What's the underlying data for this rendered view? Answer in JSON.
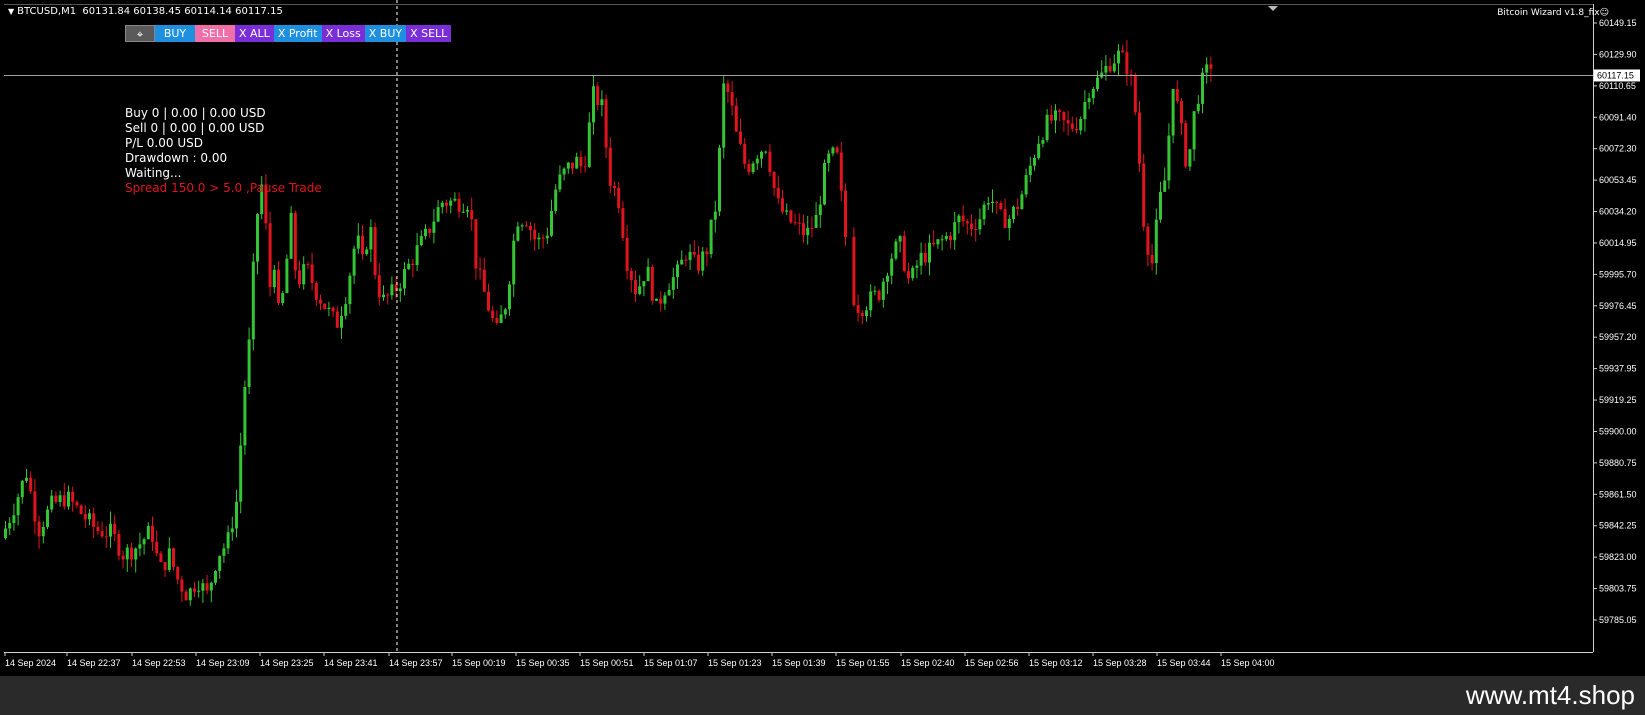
{
  "header": {
    "symbol_line": "BTCUSD,M1  60131.84 60138.45 60114.14 60117.15",
    "ea_label": "Bitcoin Wizard v1.8_fix☺"
  },
  "toolbar": {
    "move_icon": "move-icon",
    "buy": "BUY",
    "sell": "SELL",
    "x_all": "X ALL",
    "x_profit": "X Profit",
    "x_loss": "X Loss",
    "x_buy": "X BUY",
    "x_sell": "X SELL"
  },
  "info_panel": {
    "buy": "Buy  0 | 0.00 | 0.00 USD",
    "sell": "Sell  0 | 0.00 | 0.00 USD",
    "pl": "P/L 0.00 USD",
    "drawdown": "Drawdown : 0.00",
    "status": "Waiting...",
    "spread": "Spread 150.0 > 5.0 ,Pause Trade"
  },
  "watermark": "www.mt4.shop",
  "colors": {
    "bull": "#34c534",
    "bear": "#e0141e",
    "background": "#000000",
    "price_line": "#a0a0a0"
  },
  "chart_data": {
    "type": "candlestick",
    "symbol": "BTCUSD",
    "timeframe": "M1",
    "current_price": "60117.15",
    "ylim": [
      59785.05,
      60149.15
    ],
    "y_ticks": [
      "60149.15",
      "60129.90",
      "60110.65",
      "60091.40",
      "60072.30",
      "60053.45",
      "60034.20",
      "60014.95",
      "59995.70",
      "59976.45",
      "59957.20",
      "59937.95",
      "59919.25",
      "59900.00",
      "59880.75",
      "59861.50",
      "59842.25",
      "59823.00",
      "59803.75",
      "59785.05"
    ],
    "x_ticks": [
      "14 Sep 2024",
      "14 Sep 22:37",
      "14 Sep 22:53",
      "14 Sep 23:09",
      "14 Sep 23:25",
      "14 Sep 23:41",
      "14 Sep 23:57",
      "15 Sep 00:19",
      "15 Sep 00:35",
      "15 Sep 00:51",
      "15 Sep 01:07",
      "15 Sep 01:23",
      "15 Sep 01:39",
      "15 Sep 01:55",
      "15 Sep 02:40",
      "15 Sep 02:56",
      "15 Sep 03:12",
      "15 Sep 03:28",
      "15 Sep 03:44",
      "15 Sep 04:00"
    ],
    "close_path": [
      [
        0,
        59835
      ],
      [
        10,
        59850
      ],
      [
        25,
        59875
      ],
      [
        37,
        59840
      ],
      [
        50,
        59855
      ],
      [
        65,
        59860
      ],
      [
        80,
        59850
      ],
      [
        95,
        59840
      ],
      [
        110,
        59838
      ],
      [
        122,
        59825
      ],
      [
        136,
        59830
      ],
      [
        150,
        59840
      ],
      [
        158,
        59815
      ],
      [
        168,
        59825
      ],
      [
        176,
        59810
      ],
      [
        186,
        59800
      ],
      [
        196,
        59810
      ],
      [
        206,
        59800
      ],
      [
        216,
        59825
      ],
      [
        226,
        59832
      ],
      [
        236,
        59860
      ],
      [
        242,
        59920
      ],
      [
        248,
        59955
      ],
      [
        252,
        60000
      ],
      [
        258,
        60050
      ],
      [
        262,
        60050
      ],
      [
        268,
        59985
      ],
      [
        272,
        60010
      ],
      [
        278,
        59965
      ],
      [
        290,
        60030
      ],
      [
        295,
        59990
      ],
      [
        305,
        60000
      ],
      [
        315,
        59985
      ],
      [
        325,
        59975
      ],
      [
        335,
        59965
      ],
      [
        345,
        59985
      ],
      [
        355,
        60020
      ],
      [
        362,
        60000
      ],
      [
        368,
        60030
      ],
      [
        375,
        59990
      ],
      [
        382,
        59980
      ],
      [
        392,
        59985
      ],
      [
        402,
        59995
      ],
      [
        415,
        60010
      ],
      [
        425,
        60020
      ],
      [
        440,
        60040
      ],
      [
        455,
        60040
      ],
      [
        468,
        60040
      ],
      [
        475,
        60000
      ],
      [
        485,
        59980
      ],
      [
        495,
        59960
      ],
      [
        505,
        59980
      ],
      [
        515,
        60030
      ],
      [
        525,
        60030
      ],
      [
        535,
        60015
      ],
      [
        545,
        60020
      ],
      [
        555,
        60050
      ],
      [
        565,
        60060
      ],
      [
        575,
        60065
      ],
      [
        582,
        60060
      ],
      [
        592,
        60105
      ],
      [
        600,
        60100
      ],
      [
        608,
        60055
      ],
      [
        618,
        60040
      ],
      [
        625,
        60005
      ],
      [
        635,
        59985
      ],
      [
        645,
        60000
      ],
      [
        655,
        59975
      ],
      [
        665,
        59990
      ],
      [
        675,
        59995
      ],
      [
        685,
        60010
      ],
      [
        695,
        60000
      ],
      [
        705,
        60010
      ],
      [
        715,
        60040
      ],
      [
        722,
        60110
      ],
      [
        728,
        60105
      ],
      [
        735,
        60080
      ],
      [
        745,
        60060
      ],
      [
        755,
        60070
      ],
      [
        765,
        60075
      ],
      [
        775,
        60040
      ],
      [
        785,
        60030
      ],
      [
        795,
        60025
      ],
      [
        805,
        60020
      ],
      [
        815,
        60030
      ],
      [
        825,
        60065
      ],
      [
        835,
        60070
      ],
      [
        850,
        59985
      ],
      [
        858,
        59975
      ],
      [
        868,
        59980
      ],
      [
        878,
        59985
      ],
      [
        888,
        60005
      ],
      [
        898,
        60015
      ],
      [
        908,
        59990
      ],
      [
        918,
        60005
      ],
      [
        928,
        60010
      ],
      [
        938,
        60015
      ],
      [
        948,
        60020
      ],
      [
        958,
        60030
      ],
      [
        968,
        60025
      ],
      [
        978,
        60030
      ],
      [
        988,
        60045
      ],
      [
        998,
        60030
      ],
      [
        1008,
        60030
      ],
      [
        1018,
        60040
      ],
      [
        1028,
        60060
      ],
      [
        1038,
        60080
      ],
      [
        1048,
        60090
      ],
      [
        1058,
        60090
      ],
      [
        1068,
        60085
      ],
      [
        1078,
        60090
      ],
      [
        1088,
        60110
      ],
      [
        1098,
        60115
      ],
      [
        1108,
        60125
      ],
      [
        1118,
        60130
      ],
      [
        1128,
        60120
      ],
      [
        1135,
        60090
      ],
      [
        1142,
        60030
      ],
      [
        1150,
        60000
      ],
      [
        1158,
        60040
      ],
      [
        1166,
        60060
      ],
      [
        1170,
        60120
      ],
      [
        1178,
        60090
      ],
      [
        1186,
        60060
      ],
      [
        1194,
        60100
      ],
      [
        1202,
        60115
      ],
      [
        1210,
        60125
      ]
    ]
  }
}
